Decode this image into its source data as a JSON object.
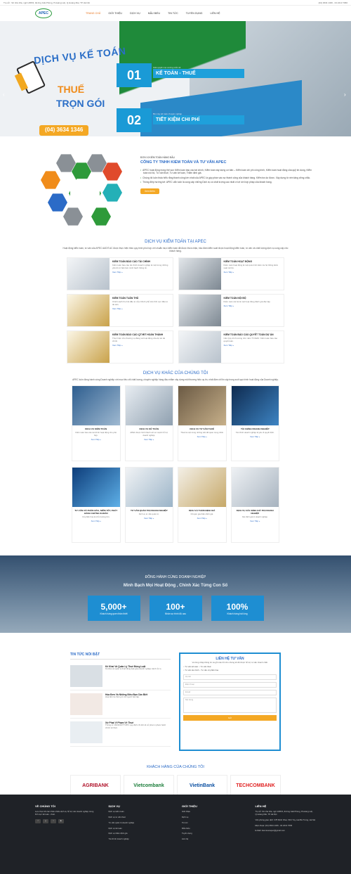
{
  "topbar": {
    "left": "Trụ sở : Số nhà 16a, ngõ 1295/3, đường Giải Phóng, P.Hoàng Liệt, Q.Hoàng Mai, TP Hà Nội",
    "right": "(04) 3634 1346 - 04 2213 7066"
  },
  "logo": "APEC",
  "nav": [
    "TRANG CHỦ",
    "GIỚI THIỆU",
    "DỊCH VỤ",
    "MẪU BIỂU",
    "TIN TỨC",
    "TUYỂN DỤNG",
    "LIÊN HỆ"
  ],
  "hero": {
    "title_line1": "DỊCH VỤ KẾ TOÁN",
    "title_line2": "THUẾ",
    "title_line3": "TRỌN GÓI",
    "phone": "(04) 3634 1346",
    "slide1": {
      "num": "01",
      "small": "Giải quyết mọi vướng mắc về",
      "big": "KẾ TOÁN - THUẾ"
    },
    "slide2": {
      "num": "02",
      "small": "Bộ máy kế toán chuyên nghiệp",
      "big": "TIẾT KIỆM CHI PHÍ"
    }
  },
  "about": {
    "sub": "ĐƠN VỊ KIỂM TOÁN HÀNG ĐẦU",
    "title": "CÔNG TY TNHH KIỂM TOÁN VÀ TƯ VẤN APEC",
    "bullets": [
      "APEC hoạt động trong thế sực Kiểm toán báo cáo tài chính, Kiểm toán xây dựng cơ bản – Kiểm toán chi phí công trình, Kiểm toán hoạt động của quỹ tín dụng, Kiểm toán nội bộ, Tư vấn thuế, Tư vấn kế toán, Thẩm định giá.",
      "Chúng tôi luôn thấu hiểu rằng thành công lớn nhất của APEC là góp phần vào sự thành công của khách hàng. Kiểm tra dự được. Xây dựng từ nền tảng vững chắc.",
      "Thông điệp hướng tới: APEC vẫn luôn là cung cấp những Dịch vụ có chất lượng cao nhất vì lợi ích hợp pháp của khách hàng."
    ],
    "button": "Xem thêm"
  },
  "audit": {
    "title": "DỊCH VỤ KIỂM TOÁN TẠI APEC",
    "desc": "Hoạt động kiểm toán, tư vấn của APEC AUDIT.AC được thực hiện theo quy trình phù hợp với chuẩn mực kiểm toán đã được thừa nhận, bảo đảm kiểm soát được hoạt động kiểm toán, tư vấn và chất lượng dịch vụ cung cấp cho khách hàng.",
    "cards": [
      {
        "title": "KIỂM TOÁN BÁO CÁO TÀI CHÍNH",
        "text": "Kiểm toán báo cáo tài chính doanh nghiệp là một trong những yếu tố cơ bản làm minh bạch thông tin.",
        "more": "Xem Tiếp »"
      },
      {
        "title": "KIỂM TOÁN HOẠT ĐỘNG",
        "text": "Kiểm toán hoạt động là một quá trình kiểm tra hệ thống kiểm soát nội bộ.",
        "more": "Xem Tiếp »"
      },
      {
        "title": "KIỂM TOÁN TUÂN THỦ",
        "text": "Chính sách thu hút đầu tư của Chính phủ trên lĩnh vực đầu tư tài sản.",
        "more": "Xem Tiếp »"
      },
      {
        "title": "KIỂM TOÁN NỘI BỘ",
        "text": "Kiểm toán nội bộ là một hoạt động đánh giá độc lập.",
        "more": "Xem Tiếp »"
      },
      {
        "title": "KIỂM TOÁN BÁO CÁO QTVĐT HOÀN THÀNH",
        "text": "Thực hiện cho thương vụ đáng và hoạt động của dự án tài chính.",
        "more": "Xem Tiếp »"
      },
      {
        "title": "KIỂM TOÁN BÁO CÁO QUYẾT TOÁN DỰ ÁN",
        "text": "Căn Quy trình tương như năm 'TCNHS'. Kiểm toán báo cáo quyết toán.",
        "more": "Xem Tiếp »"
      }
    ]
  },
  "other": {
    "title": "DỊCH VỤ KHÁC CỦA CHÚNG TÔI",
    "desc": "APEC luôn đồng hành cùng Doanh nghiệp với mục tiêu chỉ chất lượng, chuyên nghiệp hàng đầu nhằm xây dựng một thương hiệu uy tín, nhất đảm chỉ tin cậy trong suốt quá trình hoạt động của Doanh nghiệp.",
    "services": [
      {
        "title": "DỊCH VỤ KIỂM TOÁN",
        "text": "Kiểm toán báo cáo tài chính hoạt động cho phù hợp.",
        "more": "Xem Tiếp »"
      },
      {
        "title": "DỊCH VỤ KẾ TOÁN",
        "text": "APEC được hình thành với sứ mệnh hỗ trợ doanh nghiệp.",
        "more": "Xem Tiếp »"
      },
      {
        "title": "DỊCH VỤ TƯ VẤN THUẾ",
        "text": "Thuế là một trong những vấn đề quan trọng nhất.",
        "more": "Xem Tiếp »"
      },
      {
        "title": "TÀI CHÍNH DOANH NGHIỆP",
        "text": "Tài chính doanh nghiệp là yếu tố quyết định.",
        "more": "Xem Tiếp »"
      },
      {
        "title": "TƯ VẤN CỔ PHẦN HÓA, NIÊM YẾT, PHÁT HÀNH CHỨNG KHOÁN",
        "text": "Cổ phần hóa là chủ trương lớn.",
        "more": "Xem Tiếp »"
      },
      {
        "title": "TƯ VẤN QUẢN TRỊ DOANH NGHIỆP",
        "text": "Dịch vụ tư vấn quản trị.",
        "more": "Xem Tiếp »"
      },
      {
        "title": "DỊCH VỤ THẨM ĐỊNH GIÁ",
        "text": "Chuyên gia thẩm định giá.",
        "more": "Xem Tiếp »"
      },
      {
        "title": "DỊCH VỤ XÁC ĐỊNH GIÁ TRỊ DOANH NGHIỆP",
        "text": "Xác định giá trị doanh nghiệp.",
        "more": "Xem Tiếp »"
      }
    ]
  },
  "stats": {
    "heading": "ĐỒNG HÀNH CÙNG DOANH NGHIỆP",
    "sub": "Minh Bạch Mọi Hoạt Động , Chính Xác Từng Con Số",
    "items": [
      {
        "value": "5,000+",
        "label": "Khách hàng quen thân thiết"
      },
      {
        "value": "100+",
        "label": "Nhân sự trình độ cao"
      },
      {
        "value": "100%",
        "label": "Khách hàng hài lòng"
      }
    ]
  },
  "news": {
    "title": "TIN TỨC NỔI BẬT",
    "items": [
      {
        "title": "Kế Khai Và Quản Lý Thuế Đúng Luật",
        "text": "Kê khai và quản lý thuế đúng luật giúp doanh nghiệp tránh rủi ro."
      },
      {
        "title": "Hóa Đơn Và Những Điều Bạn Cần Biết",
        "text": "Hóa đơn là chứng từ do người bán lập."
      },
      {
        "title": "Xử Phạt Vi Phạm Về Thuế",
        "text": "Thông tư 166/2013/TT-BTC quy định chi tiết về xử phạt vi phạm hành chính về thuế."
      }
    ]
  },
  "contact": {
    "title": "LIÊN HỆ TƯ VẤN",
    "desc": "Vui lòng nhập thông tin và gửi câu hỏi cho chúng tôi để được hỗ trợ tư vấn nhanh nhất.",
    "options": [
      "Tư vấn kế toán",
      "Tư vấn thuế",
      "Tư vấn tài chính - Tư vấn cổ phần hóa"
    ],
    "fields": [
      "Họ tên",
      "Điện thoại",
      "Email",
      "Nội dung"
    ],
    "send": "Gửi"
  },
  "clients": {
    "title": "KHÁCH HÀNG CỦA CHÚNG TÔI",
    "items": [
      "AGRIBANK",
      "Vietcombank",
      "VietinBank",
      "TECHCOMBANK"
    ]
  },
  "footer": {
    "about_title": "VỀ CHÚNG TÔI",
    "about_text": "Lựa chọn tốt các nhân nhiều dịch vụ hỗ trợ các doanh nghiệp trong lĩnh vực kế toán - thuế.",
    "services_title": "DỊCH VỤ",
    "services": [
      "Dịch vụ kiểm toán",
      "Dịch vụ tư vấn thuế",
      "Tư vấn quản trị doanh nghiệp",
      "Dịch vụ kế toán",
      "Dịch vụ thẩm định giá",
      "Tài chính doanh nghiệp"
    ],
    "intro_title": "GIỚI THIỆU",
    "intro": [
      "Giới thiệu",
      "Dịch vụ",
      "Tin tức",
      "Mẫu biểu",
      "Tuyển dụng",
      "Liên hệ"
    ],
    "contact_title": "LIÊN HỆ",
    "contact": [
      "Trụ sở: Số nhà 16a, ngõ 1295/3, đường Giải Phóng, P.Hoàng Liệt, Q.Hoàng Mai, TP Hà Nội",
      "Văn phòng giao dịch: 378 Minh Khai, Vĩnh Tuy, Hai Bà Trưng, Hà Nội",
      "Điện thoại: (04) 3634 1346 - 04 2213 7066",
      "E-Mail: kiemtoanapec@gmail.com"
    ]
  }
}
